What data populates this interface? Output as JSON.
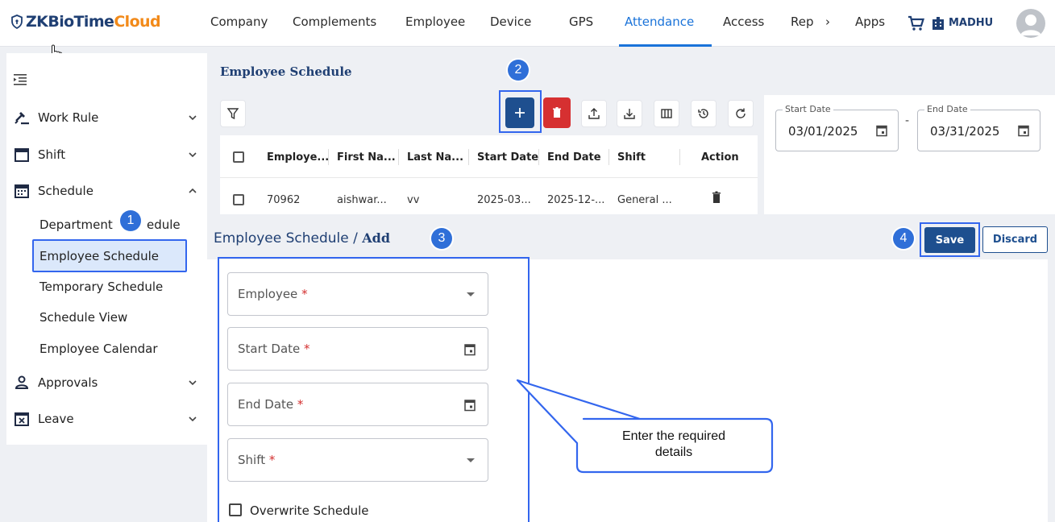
{
  "header": {
    "logo_prefix": "ZK",
    "logo_mid": "BioTime",
    "logo_suffix": "Cloud",
    "nav": [
      "Company",
      "Complements",
      "Employee",
      "Device",
      "GPS",
      "Attendance",
      "Access",
      "Rep",
      "›",
      "Apps"
    ],
    "active_nav": "Attendance",
    "org_name": "MADHU"
  },
  "sidebar": {
    "items": [
      {
        "label": "Work Rule",
        "icon": "gavel-icon",
        "expanded": false
      },
      {
        "label": "Shift",
        "icon": "calendar-icon",
        "expanded": false
      },
      {
        "label": "Schedule",
        "icon": "calendar-grid-icon",
        "expanded": true
      },
      {
        "label": "Approvals",
        "icon": "person-check-icon",
        "expanded": false
      },
      {
        "label": "Leave",
        "icon": "calendar-x-icon",
        "expanded": false
      }
    ],
    "schedule_subitems": [
      "Department Schedule",
      "Employee Schedule",
      "Temporary Schedule",
      "Schedule View",
      "Employee Calendar"
    ],
    "selected_subitem": "Employee Schedule",
    "dept_label_visible_left": "Department",
    "dept_label_visible_right": "edule"
  },
  "list_panel": {
    "title": "Employee Schedule",
    "columns": [
      "Employe...",
      "First Na...",
      "Last Na...",
      "Start Date",
      "End Date",
      "Shift",
      "Action"
    ],
    "rows": [
      {
        "employee": "70962",
        "first_name": "aishwar...",
        "last_name": "vv",
        "start_date": "2025-03...",
        "end_date": "2025-12-...",
        "shift": "General ..."
      }
    ]
  },
  "date_range": {
    "start_label": "Start Date",
    "start_value": "03/01/2025",
    "separator": "-",
    "end_label": "End Date",
    "end_value": "03/31/2025"
  },
  "form": {
    "breadcrumb_parent": "Employee Schedule",
    "breadcrumb_sep": "/",
    "breadcrumb_current": "Add",
    "save_label": "Save",
    "discard_label": "Discard",
    "fields": [
      {
        "label": "Employee",
        "required": "*",
        "type": "select"
      },
      {
        "label": "Start Date",
        "required": "*",
        "type": "date"
      },
      {
        "label": "End Date",
        "required": "*",
        "type": "date"
      },
      {
        "label": "Shift",
        "required": "*",
        "type": "select"
      }
    ],
    "overwrite_label": "Overwrite Schedule"
  },
  "annotations": {
    "badges": [
      "1",
      "2",
      "3",
      "4"
    ],
    "callout_line1": "Enter the required",
    "callout_line2": "details",
    "highlight_color": "#3366ee"
  },
  "colors": {
    "brand_navy": "#1f3f73",
    "brand_orange": "#f28a1a",
    "accent_blue": "#1a73d9",
    "primary_button": "#1e4f8f",
    "delete_red": "#d63031"
  }
}
